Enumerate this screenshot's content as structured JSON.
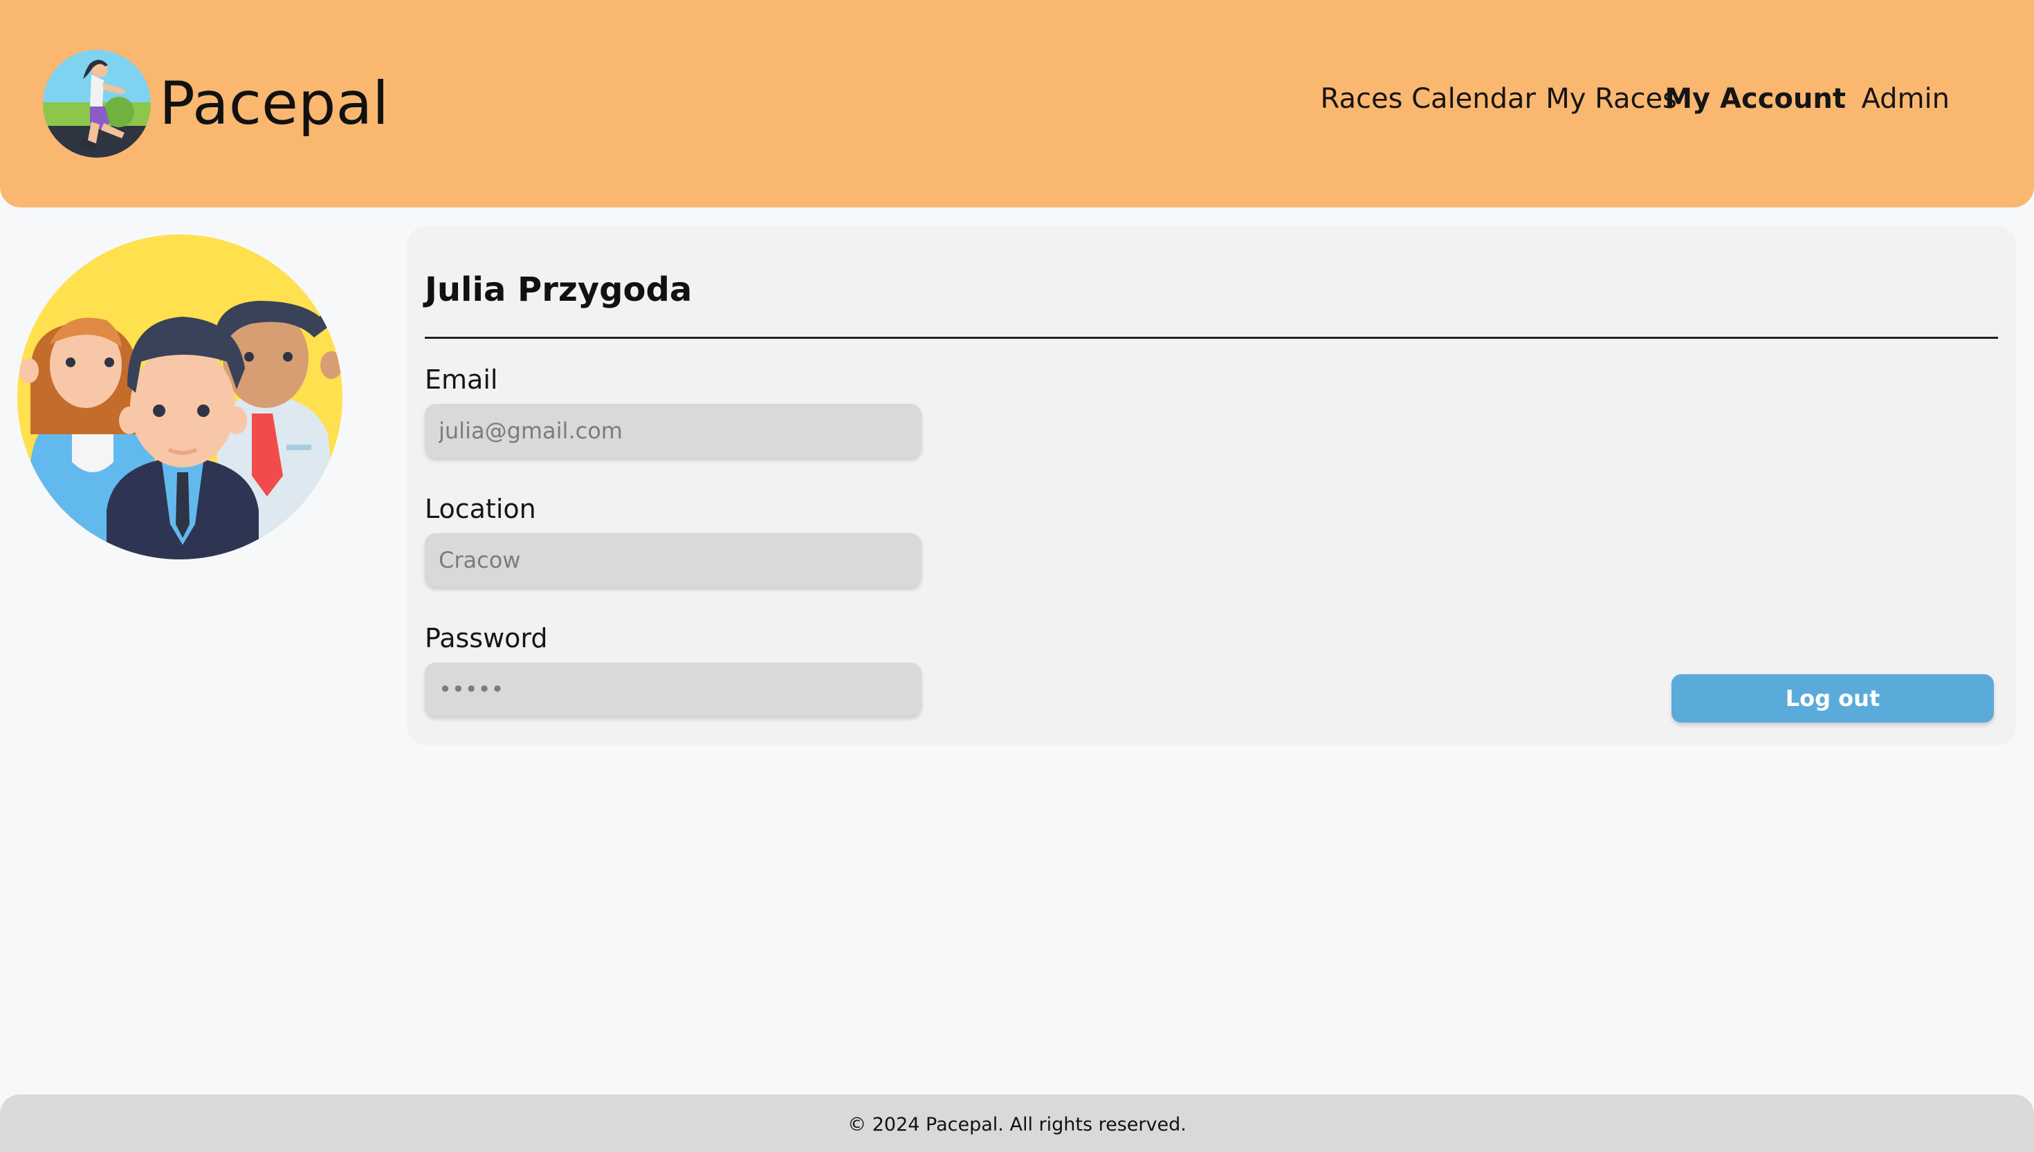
{
  "header": {
    "brand": "Pacepal",
    "logo_icon": "runner-icon",
    "nav": [
      {
        "label": "Races Calendar",
        "active": false
      },
      {
        "label": "My Races",
        "active": false
      },
      {
        "label": "My Account",
        "active": true
      },
      {
        "label": "Admin",
        "active": false
      }
    ]
  },
  "profile": {
    "avatar_icon": "people-group-icon",
    "name": "Julia Przygoda",
    "fields": [
      {
        "label": "Email",
        "placeholder": "julia@gmail.com",
        "type": "text"
      },
      {
        "label": "Location",
        "placeholder": "Cracow",
        "type": "text"
      },
      {
        "label": "Password",
        "placeholder": "•••••",
        "type": "password"
      }
    ],
    "logout_label": "Log out"
  },
  "footer": {
    "text": "© 2024 Pacepal. All rights reserved."
  },
  "colors": {
    "header_bg": "#f9b770",
    "page_bg": "#f7f8fa",
    "card_bg": "#f2f2f2",
    "input_bg": "#d9d9d9",
    "button_bg": "#5aabda",
    "footer_bg": "#d9d9d9"
  }
}
